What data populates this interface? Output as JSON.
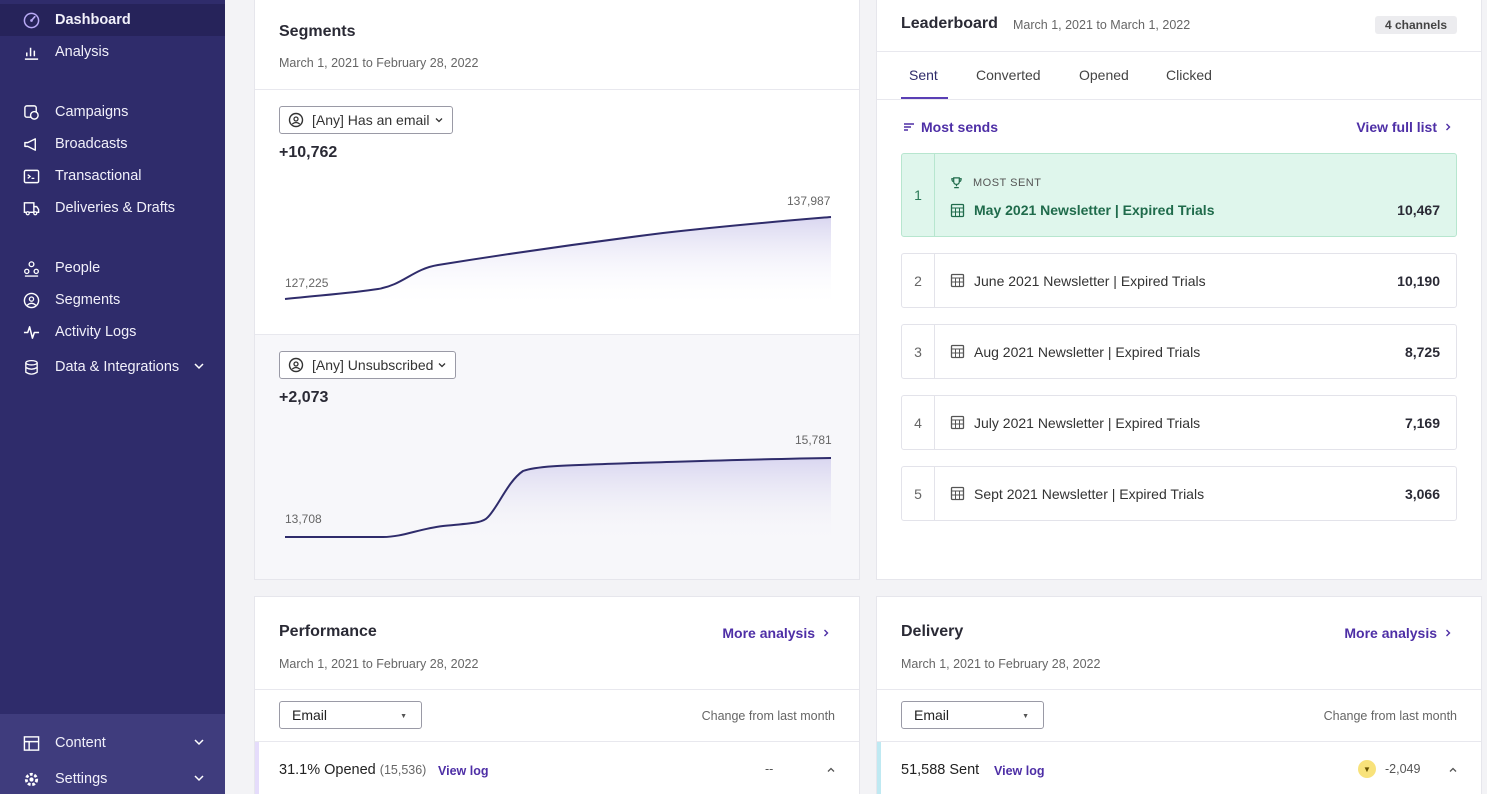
{
  "sidebar": {
    "items": [
      {
        "label": "Dashboard",
        "icon": "dashboard-icon"
      },
      {
        "label": "Analysis",
        "icon": "bar-chart-icon"
      },
      {
        "label": "Campaigns",
        "icon": "campaign-icon"
      },
      {
        "label": "Broadcasts",
        "icon": "megaphone-icon"
      },
      {
        "label": "Transactional",
        "icon": "terminal-icon"
      },
      {
        "label": "Deliveries & Drafts",
        "icon": "truck-icon"
      },
      {
        "label": "People",
        "icon": "people-icon"
      },
      {
        "label": "Segments",
        "icon": "segments-icon"
      },
      {
        "label": "Activity Logs",
        "icon": "activity-icon"
      },
      {
        "label": "Data & Integrations",
        "icon": "database-icon"
      },
      {
        "label": "Content",
        "icon": "content-icon"
      },
      {
        "label": "Settings",
        "icon": "gear-icon"
      }
    ]
  },
  "segments": {
    "title": "Segments",
    "date_range": "March 1, 2021 to February 28, 2022",
    "items": [
      {
        "select": "[Any] Has an email",
        "delta": "+10,762",
        "start_label": "127,225",
        "end_label": "137,987"
      },
      {
        "select": "[Any] Unsubscribed",
        "delta": "+2,073",
        "start_label": "13,708",
        "end_label": "15,781"
      }
    ]
  },
  "leaderboard": {
    "title": "Leaderboard",
    "date_range": "March 1, 2021 to March 1, 2022",
    "badge": "4 channels",
    "tabs": [
      "Sent",
      "Converted",
      "Opened",
      "Clicked"
    ],
    "sort_label": "Most sends",
    "view_full": "View full list",
    "most_sent_label": "MOST SENT",
    "rows": [
      {
        "rank": "1",
        "name": "May 2021 Newsletter | Expired Trials",
        "value": "10,467"
      },
      {
        "rank": "2",
        "name": "June 2021 Newsletter | Expired Trials",
        "value": "10,190"
      },
      {
        "rank": "3",
        "name": "Aug 2021 Newsletter | Expired Trials",
        "value": "8,725"
      },
      {
        "rank": "4",
        "name": "July 2021 Newsletter | Expired Trials",
        "value": "7,169"
      },
      {
        "rank": "5",
        "name": "Sept 2021 Newsletter | Expired Trials",
        "value": "3,066"
      }
    ]
  },
  "performance": {
    "title": "Performance",
    "more": "More analysis",
    "date_range": "March 1, 2021 to February 28, 2022",
    "select": "Email",
    "change_label": "Change from last month",
    "metric": {
      "main": "31.1% Opened",
      "sub": "(15,536)",
      "view_log": "View log",
      "change": "--"
    }
  },
  "delivery": {
    "title": "Delivery",
    "more": "More analysis",
    "date_range": "March 1, 2021 to February 28, 2022",
    "select": "Email",
    "change_label": "Change from last month",
    "metric": {
      "main": "51,588 Sent",
      "view_log": "View log",
      "change": "-2,049"
    }
  },
  "colors": {
    "sidebar_bg": "#2f2c6b",
    "accent": "#4e2fa6",
    "top_row_bg": "#dff6ec",
    "sparkline": "#2f2c6b"
  }
}
